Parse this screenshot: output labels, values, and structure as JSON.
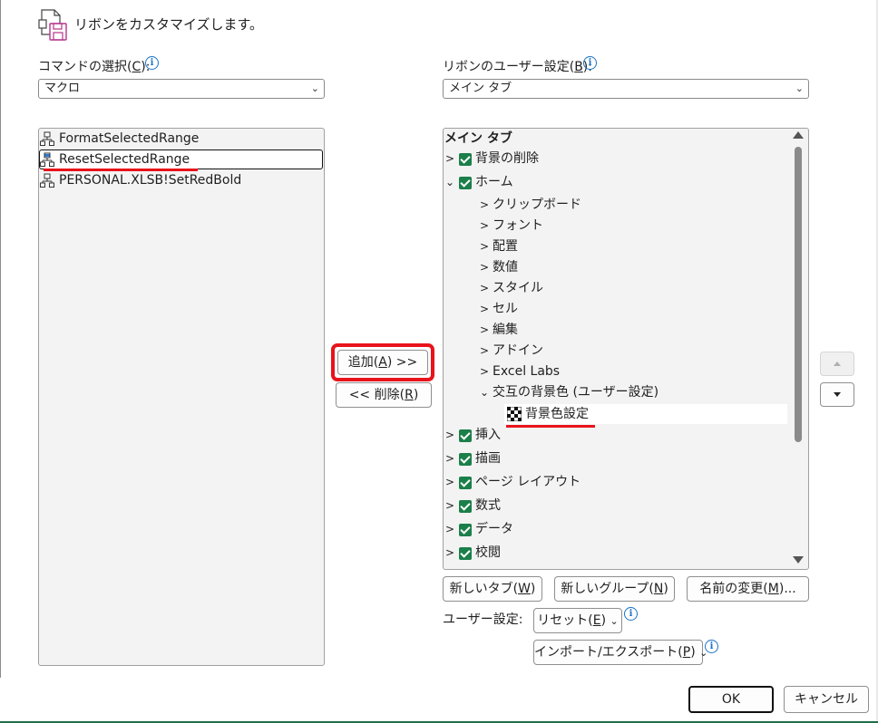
{
  "header": {
    "title": "リボンをカスタマイズします。"
  },
  "left": {
    "label_prefix": "コマンドの選択(",
    "label_key": "C",
    "label_suffix": "):",
    "combo_value": "マクロ",
    "items": [
      {
        "label": "FormatSelectedRange"
      },
      {
        "label": "ResetSelectedRange"
      },
      {
        "label": "PERSONAL.XLSB!SetRedBold"
      }
    ]
  },
  "middle": {
    "add_prefix": "追加(",
    "add_key": "A",
    "add_suffix": ") >>",
    "remove_prefix": "<< 削除(",
    "remove_key": "R",
    "remove_suffix": ")"
  },
  "right": {
    "label_prefix": "リボンのユーザー設定(",
    "label_key": "B",
    "label_suffix": "):",
    "combo_value": "メイン タブ",
    "tree_header": "メイン タブ",
    "tree": [
      {
        "label": "背景の削除",
        "level": 0,
        "expander": ">",
        "checkbox": true
      },
      {
        "label": "ホーム",
        "level": 0,
        "expander": "v",
        "checkbox": true
      },
      {
        "label": "クリップボード",
        "level": 1,
        "expander": ">"
      },
      {
        "label": "フォント",
        "level": 1,
        "expander": ">"
      },
      {
        "label": "配置",
        "level": 1,
        "expander": ">"
      },
      {
        "label": "数値",
        "level": 1,
        "expander": ">"
      },
      {
        "label": "スタイル",
        "level": 1,
        "expander": ">"
      },
      {
        "label": "セル",
        "level": 1,
        "expander": ">"
      },
      {
        "label": "編集",
        "level": 1,
        "expander": ">"
      },
      {
        "label": "アドイン",
        "level": 1,
        "expander": ">"
      },
      {
        "label": "Excel Labs",
        "level": 1,
        "expander": ">"
      },
      {
        "label": "交互の背景色 (ユーザー設定)",
        "level": 1,
        "expander": "v"
      },
      {
        "label": "背景色設定",
        "level": 2,
        "icon": "checker-macro-icon"
      },
      {
        "label": "挿入",
        "level": 0,
        "expander": ">",
        "checkbox": true
      },
      {
        "label": "描画",
        "level": 0,
        "expander": ">",
        "checkbox": true
      },
      {
        "label": "ページ レイアウト",
        "level": 0,
        "expander": ">",
        "checkbox": true
      },
      {
        "label": "数式",
        "level": 0,
        "expander": ">",
        "checkbox": true
      },
      {
        "label": "データ",
        "level": 0,
        "expander": ">",
        "checkbox": true
      },
      {
        "label": "校閲",
        "level": 0,
        "expander": ">",
        "checkbox": true
      }
    ],
    "new_tab_prefix": "新しいタブ(",
    "new_tab_key": "W",
    "new_tab_suffix": ")",
    "new_group_prefix": "新しいグループ(",
    "new_group_key": "N",
    "new_group_suffix": ")",
    "rename_prefix": "名前の変更(",
    "rename_key": "M",
    "rename_suffix": ")...",
    "user_settings_label": "ユーザー設定:",
    "reset_prefix": "リセット(",
    "reset_key": "E",
    "reset_suffix": ")",
    "import_prefix": "インポート/エクスポート(",
    "import_key": "P",
    "import_suffix": ")"
  },
  "footer": {
    "ok": "OK",
    "cancel": "キャンセル"
  },
  "colors": {
    "checkbox": "#1b7f4a",
    "highlight": "#e8131b",
    "info": "#1a73c9"
  }
}
